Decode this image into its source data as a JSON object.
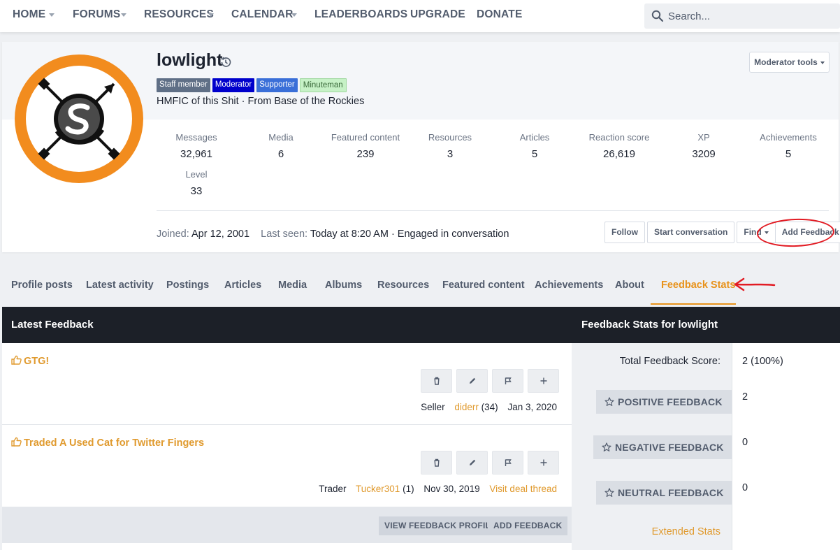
{
  "nav": {
    "items": [
      {
        "label": "HOME",
        "has_menu": true
      },
      {
        "label": "FORUMS",
        "has_menu": true
      },
      {
        "label": "RESOURCES",
        "has_menu": true
      },
      {
        "label": "CALENDAR",
        "has_menu": true
      },
      {
        "label": "LEADERBOARDS",
        "has_menu": false
      },
      {
        "label": "UPGRADE",
        "has_menu": false
      },
      {
        "label": "DONATE",
        "has_menu": false
      }
    ],
    "search_placeholder": "Search..."
  },
  "profile": {
    "username": "lowlight",
    "badges": [
      "Staff member",
      "Moderator",
      "Supporter",
      "Minuteman"
    ],
    "user_title": "HMFIC of this Shit · From Base of the Rockies",
    "moderator_tools": "Moderator tools",
    "stats": [
      {
        "label": "Messages",
        "value": "32,961"
      },
      {
        "label": "Media",
        "value": "6"
      },
      {
        "label": "Featured content",
        "value": "239"
      },
      {
        "label": "Resources",
        "value": "3"
      },
      {
        "label": "Articles",
        "value": "5"
      },
      {
        "label": "Reaction score",
        "value": "26,619"
      },
      {
        "label": "XP",
        "value": "3209"
      },
      {
        "label": "Achievements",
        "value": "5"
      },
      {
        "label": "Level",
        "value": "33"
      }
    ],
    "joined_label": "Joined:",
    "joined_value": "Apr 12, 2001",
    "last_seen_label": "Last seen:",
    "last_seen_value": "Today at 8:20 AM · Engaged in conversation",
    "actions": {
      "follow": "Follow",
      "start_conversation": "Start conversation",
      "find": "Find",
      "add_feedback": "Add Feedback"
    }
  },
  "tabs": [
    {
      "label": "Profile posts",
      "active": false
    },
    {
      "label": "Latest activity",
      "active": false
    },
    {
      "label": "Postings",
      "active": false
    },
    {
      "label": "Articles",
      "active": false
    },
    {
      "label": "Media",
      "active": false
    },
    {
      "label": "Albums",
      "active": false
    },
    {
      "label": "Resources",
      "active": false
    },
    {
      "label": "Featured content",
      "active": false
    },
    {
      "label": "Achievements",
      "active": false
    },
    {
      "label": "About",
      "active": false
    },
    {
      "label": "Feedback Stats",
      "active": true
    }
  ],
  "latest_feedback": {
    "header": "Latest Feedback",
    "items": [
      {
        "title": "GTG!",
        "role": "Seller",
        "user": "diderr",
        "count": "(34)",
        "date": "Jan 3, 2020",
        "thread_link": ""
      },
      {
        "title": "Traded A Used Cat for Twitter Fingers",
        "role": "Trader",
        "user": "Tucker301",
        "count": "(1)",
        "date": "Nov 30, 2019",
        "thread_link": "Visit deal thread"
      }
    ],
    "view_profile_button": "VIEW FEEDBACK PROFILE",
    "add_feedback_button": "ADD FEEDBACK"
  },
  "feedback_stats": {
    "header": "Feedback Stats for lowlight",
    "total_label": "Total Feedback Score:",
    "total_value": "2 (100%)",
    "positive_label": "POSITIVE FEEDBACK",
    "positive_value": "2",
    "negative_label": "NEGATIVE FEEDBACK",
    "negative_value": "0",
    "neutral_label": "NEUTRAL FEEDBACK",
    "neutral_value": "0",
    "extended_stats": "Extended Stats"
  },
  "colors": {
    "accent": "#e8921a",
    "link": "#e09a2e",
    "header_dark": "#1c2028",
    "annotation_red": "#e21b23"
  }
}
